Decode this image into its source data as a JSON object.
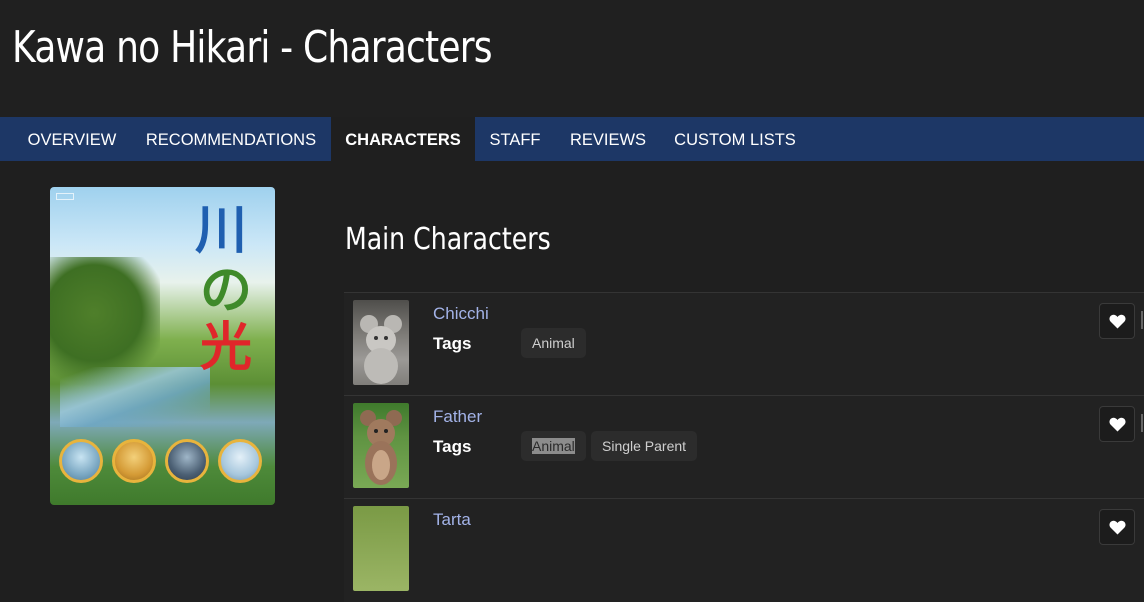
{
  "header": {
    "title": "Kawa no Hikari - Characters"
  },
  "nav": {
    "tabs": [
      {
        "label": "OVERVIEW",
        "active": false
      },
      {
        "label": "RECOMMENDATIONS",
        "active": false
      },
      {
        "label": "CHARACTERS",
        "active": true
      },
      {
        "label": "STAFF",
        "active": false
      },
      {
        "label": "REVIEWS",
        "active": false
      },
      {
        "label": "CUSTOM LISTS",
        "active": false
      }
    ]
  },
  "poster": {
    "title_glyphs": [
      "川",
      "の",
      "光"
    ]
  },
  "main": {
    "section_title": "Main Characters",
    "tags_label": "Tags",
    "characters": [
      {
        "name": "Chicchi",
        "tags": [
          "Animal"
        ]
      },
      {
        "name": "Father",
        "tags": [
          "Animal",
          "Single Parent"
        ],
        "selected_tag": "Animal"
      },
      {
        "name": "Tarta",
        "tags": []
      }
    ]
  },
  "icons": {
    "favorite": "heart-icon"
  },
  "colors": {
    "nav_bg": "#1d3766",
    "link": "#a3b3e8",
    "page_bg": "#1f1f1f"
  }
}
